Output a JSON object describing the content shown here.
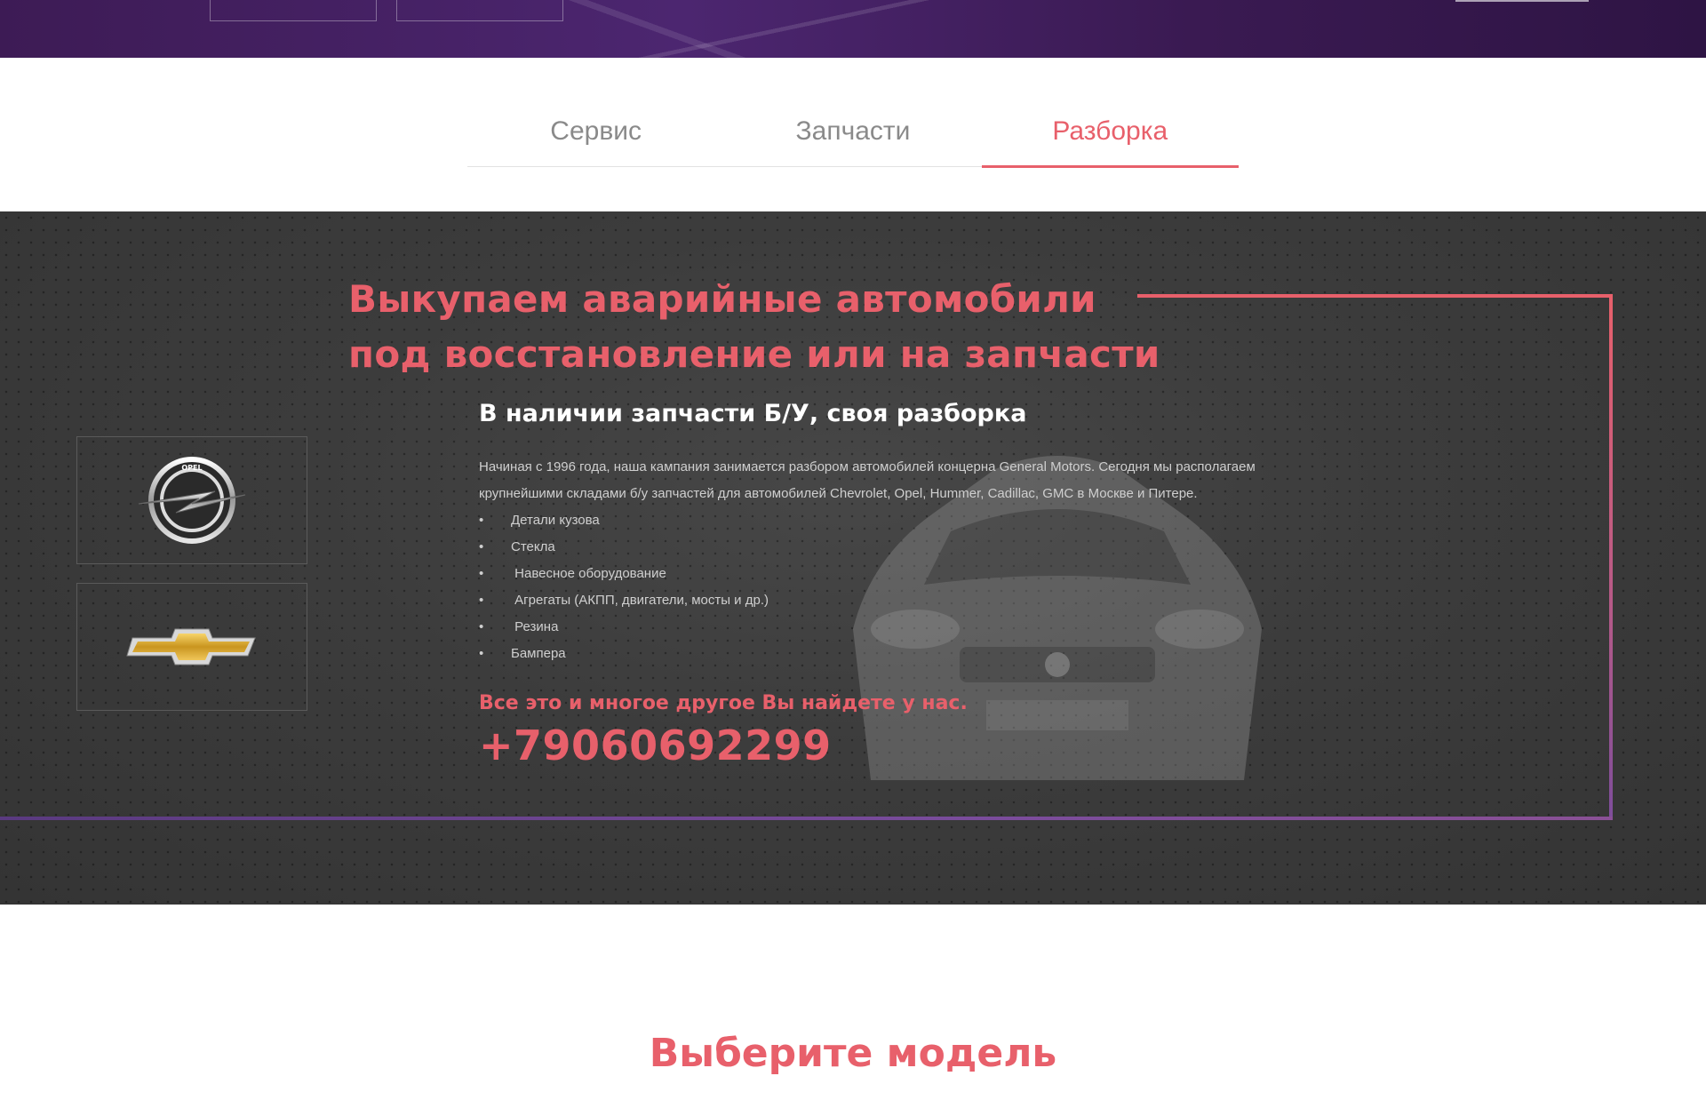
{
  "tabs": [
    {
      "label": "Сервис",
      "active": false
    },
    {
      "label": "Запчасти",
      "active": false
    },
    {
      "label": "Разборка",
      "active": true
    }
  ],
  "section": {
    "headline_line1": "Выкупаем аварийные автомобили",
    "headline_line2": "под восстановление или на запчасти",
    "sub_title": "В наличии запчасти Б/У, своя разборка",
    "description": "Начиная с 1996 года, наша кампания занимается разбором автомобилей концерна General Motors. Сегодня мы располагаем крупнейшими складами б/у запчастей для автомобилей Chevrolet, Opel, Hummer, Cadillac, GMC в Москве и Питере.",
    "bullet": "•",
    "list": [
      "Детали кузова",
      "Стекла",
      " Навесное оборудование",
      " Агрегаты (АКПП, двигатели, мосты и др.)",
      " Резина",
      "Бампера"
    ],
    "cta": "Все это и многое другое Вы найдете у нас.",
    "phone": "+79060692299"
  },
  "brands": {
    "opel_logo_text": "OPEL",
    "opel_icon": "opel-logo-icon",
    "chevrolet_icon": "chevrolet-logo-icon"
  },
  "choose_model": {
    "title": "Выберите модель"
  },
  "colors": {
    "accent": "#e8606b",
    "dark_bg": "#3a3a3a",
    "hero_purple": "#3d1b55",
    "frame_purple": "#7e4d9b"
  }
}
